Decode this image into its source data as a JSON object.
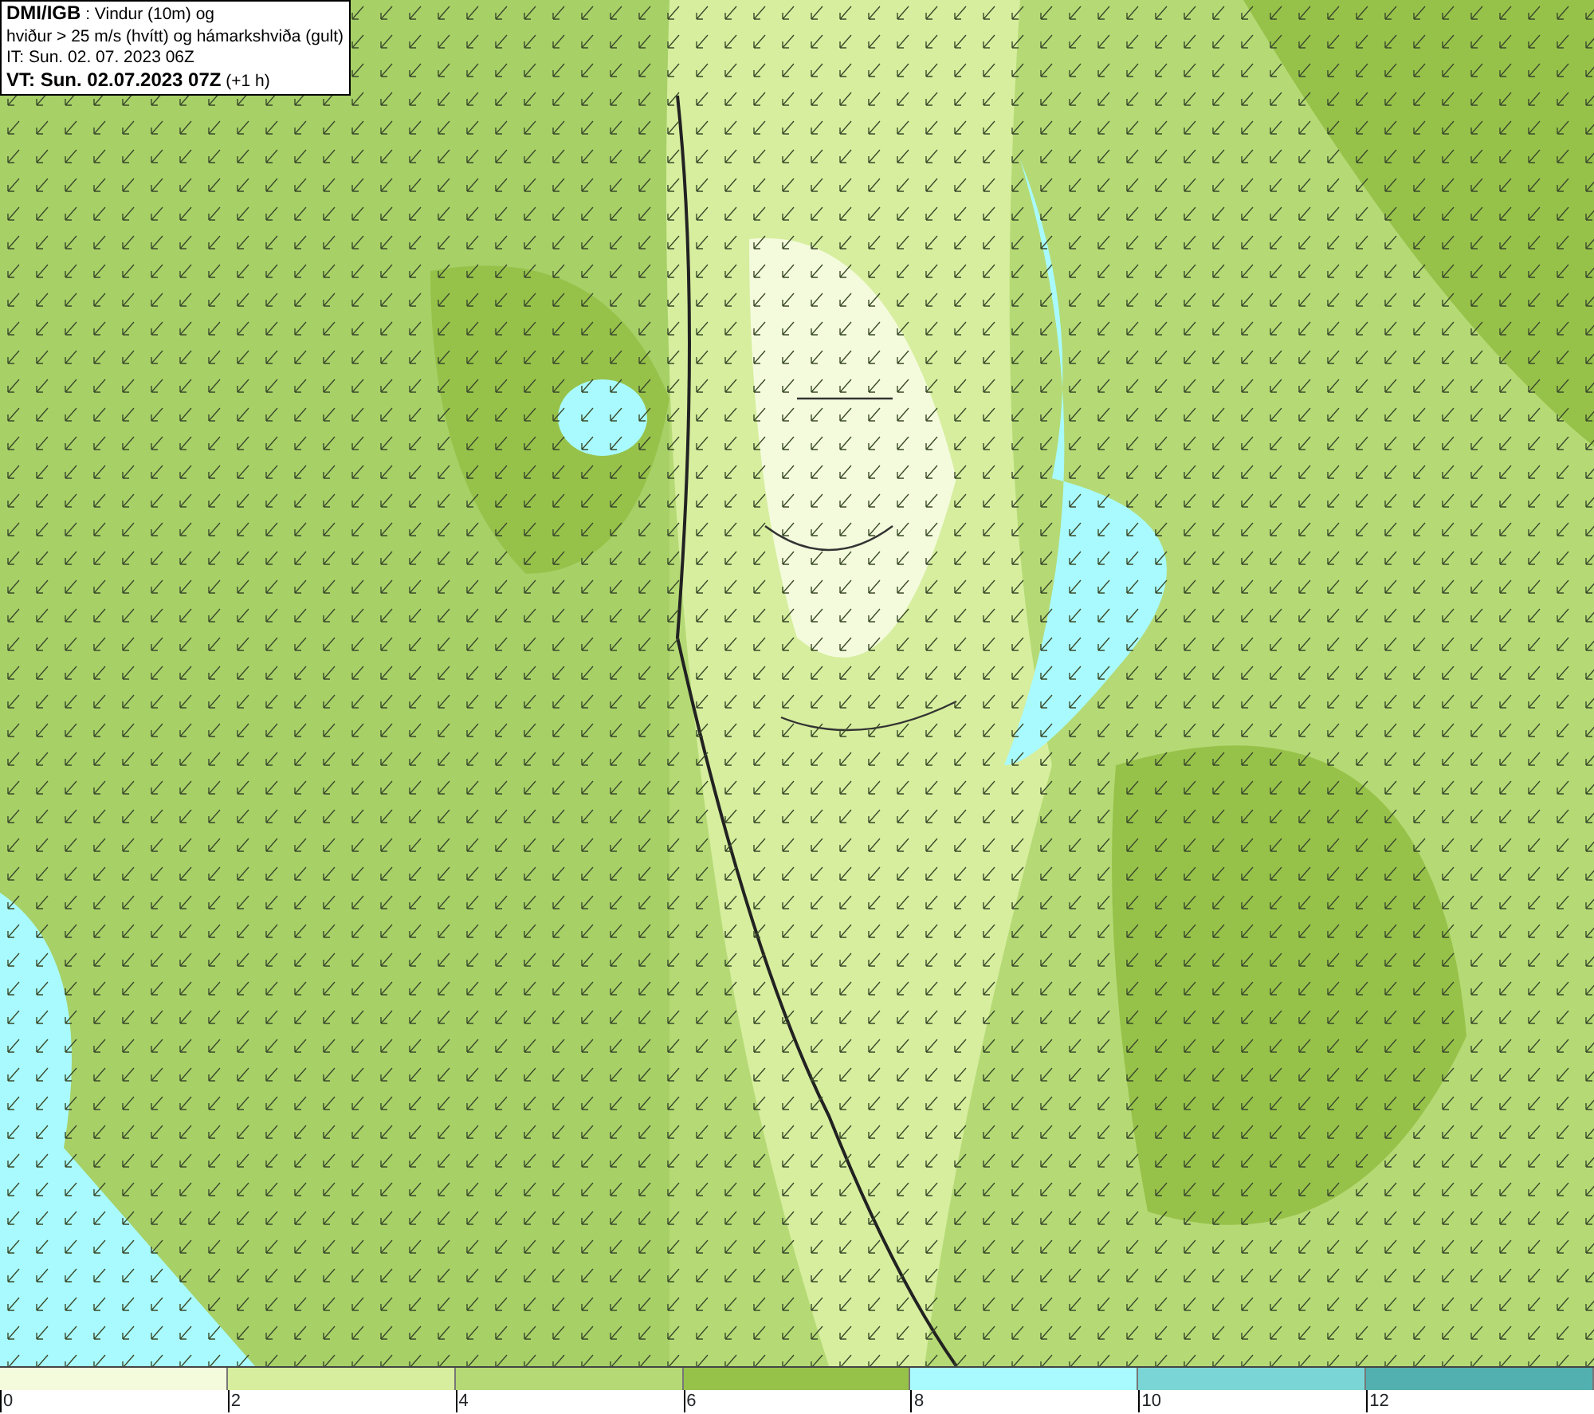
{
  "title_box": {
    "lines": [
      "**DMI/IGB** : Vindur (10m) og",
      "hviður > 25 m/s (hvítt) og hámarkshviða (gult)",
      "IT: Sun. 02. 07. 2023 06Z",
      "**VT: Sun. 02.07.2023 07Z** (+1 h)"
    ]
  },
  "legend": [
    {
      "color": "#f4fbdc",
      "label": "0"
    },
    {
      "color": "#d6ee9e",
      "label": "2"
    },
    {
      "color": "#b5da75",
      "label": "4"
    },
    {
      "color": "#97c24a",
      "label": "6"
    },
    {
      "color": "#a8faff",
      "label": "8"
    },
    {
      "color": "#7ad6d6",
      "label": "10"
    },
    {
      "color": "#52b0b0",
      "label": "12"
    }
  ]
}
